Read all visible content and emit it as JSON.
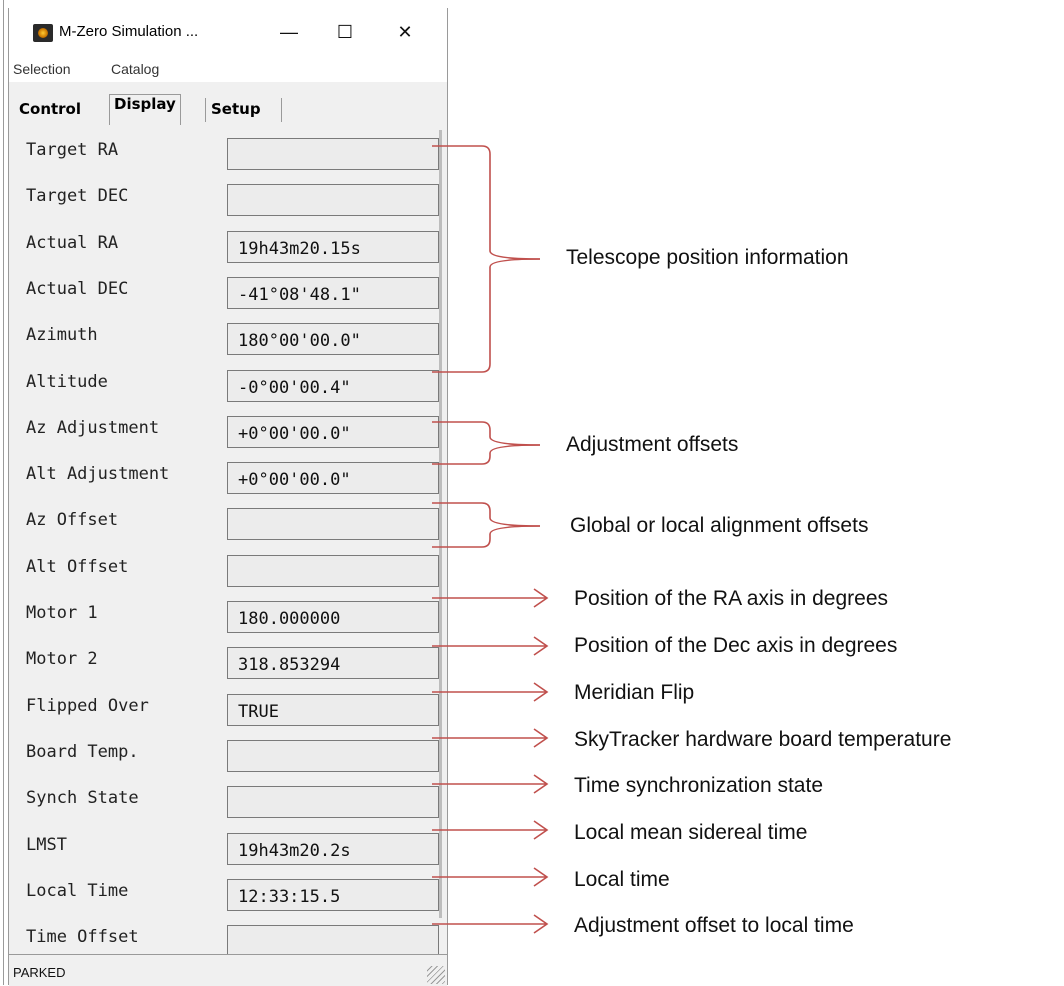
{
  "window": {
    "title": "M-Zero Simulation ...",
    "controls": {
      "minimize": "—",
      "maximize": "☐",
      "close": "✕"
    }
  },
  "menu": {
    "items": [
      "Selection",
      "Catalog"
    ]
  },
  "tabs": [
    {
      "label": "Control",
      "active": false
    },
    {
      "label": "Display",
      "active": true
    },
    {
      "label": "Setup",
      "active": false
    }
  ],
  "fields": [
    {
      "label": "Target RA",
      "value": ""
    },
    {
      "label": "Target DEC",
      "value": ""
    },
    {
      "label": "Actual RA",
      "value": "19h43m20.15s"
    },
    {
      "label": "Actual DEC",
      "value": "-41°08'48.1\""
    },
    {
      "label": "Azimuth",
      "value": "180°00'00.0\""
    },
    {
      "label": "Altitude",
      "value": "-0°00'00.4\""
    },
    {
      "label": "Az Adjustment",
      "value": "+0°00'00.0\""
    },
    {
      "label": "Alt Adjustment",
      "value": "+0°00'00.0\""
    },
    {
      "label": "Az Offset",
      "value": ""
    },
    {
      "label": "Alt Offset",
      "value": ""
    },
    {
      "label": "Motor 1",
      "value": " 180.000000"
    },
    {
      "label": "Motor 2",
      "value": " 318.853294"
    },
    {
      "label": "Flipped Over",
      "value": "TRUE"
    },
    {
      "label": "Board Temp.",
      "value": ""
    },
    {
      "label": "Synch State",
      "value": ""
    },
    {
      "label": "LMST",
      "value": "19h43m20.2s"
    },
    {
      "label": "Local Time",
      "value": "12:33:15.5"
    },
    {
      "label": "Time Offset",
      "value": ""
    }
  ],
  "status": {
    "text": "PARKED"
  },
  "annotations": {
    "telescope_position": "Telescope position information",
    "adjustment_offsets": "Adjustment offsets",
    "alignment_offsets": "Global or local alignment offsets",
    "motor1": "Position of the RA axis in degrees",
    "motor2": "Position of the Dec axis in degrees",
    "flipped": "Meridian Flip",
    "board_temp": "SkyTracker hardware board temperature",
    "synch": "Time synchronization state",
    "lmst": "Local mean sidereal time",
    "local_time": "Local time",
    "time_offset": "Adjustment offset to local time"
  },
  "colors": {
    "annotation_line": "#c0504d",
    "window_bg": "#f0f0f0"
  }
}
